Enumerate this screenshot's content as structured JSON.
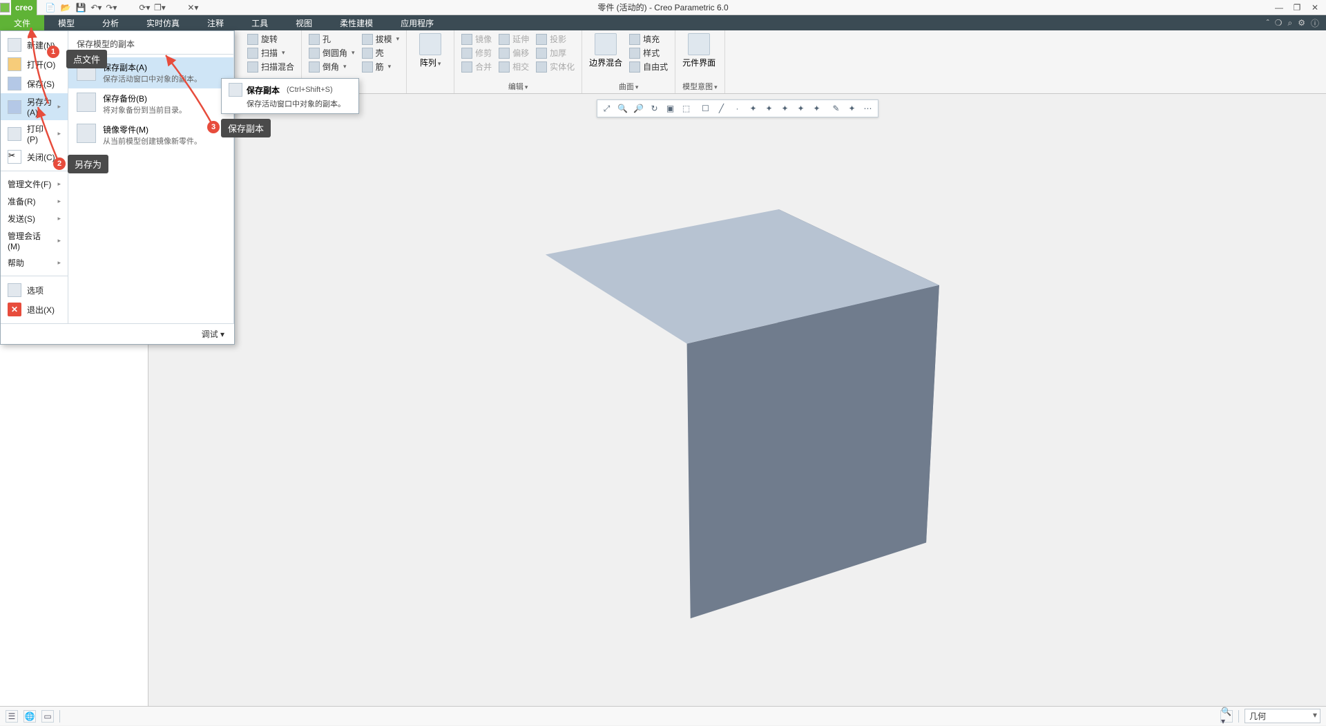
{
  "app": {
    "logo": "creo",
    "title": "零件 (活动的) - Creo Parametric 6.0"
  },
  "tabs": {
    "file": "文件",
    "model": "模型",
    "analysis": "分析",
    "realtime": "实时仿真",
    "annotate": "注释",
    "tools": "工具",
    "view": "视图",
    "flex": "柔性建模",
    "apps": "应用程序"
  },
  "ribbon": {
    "rotate": "旋转",
    "sweep": "扫描",
    "sweep_blend": "扫描混合",
    "hole": "孔",
    "round": "倒圆角",
    "chamfer": "倒角",
    "draft": "拔模",
    "shell": "壳",
    "rib": "筋",
    "pattern": "阵列",
    "mirror": "镜像",
    "trim": "修剪",
    "merge": "合并",
    "extend": "延伸",
    "offset": "偏移",
    "intersect": "相交",
    "thicken": "加厚",
    "project": "投影",
    "solidify": "实体化",
    "fill": "填充",
    "style": "样式",
    "freeform": "自由式",
    "boundary": "边界混合",
    "compui": "元件界面",
    "group_edit": "编辑",
    "group_surface": "曲面",
    "group_model_intent": "模型意图"
  },
  "file_menu": {
    "new": "新建(N)",
    "open": "打开(O)",
    "save": "保存(S)",
    "saveas": "另存为(A)",
    "print": "打印(P)",
    "close": "关闭(C)",
    "manage_file": "管理文件(F)",
    "prepare": "准备(R)",
    "send": "发送(S)",
    "manage_session": "管理会话(M)",
    "help": "帮助",
    "options": "选项",
    "exit": "退出(X)",
    "debug": "调试",
    "col2_header": "保存模型的副本",
    "save_copy_t": "保存副本(A)",
    "save_copy_d": "保存活动窗口中对象的副本。",
    "backup_t": "保存备份(B)",
    "backup_d": "将对象备份到当前目录。",
    "mirror_t": "镜像零件(M)",
    "mirror_d": "从当前模型创建镜像新零件。"
  },
  "tooltip": {
    "title": "保存副本",
    "shortcut": "(Ctrl+Shift+S)",
    "desc": "保存活动窗口中对象的副本。"
  },
  "callouts": {
    "n1": "1",
    "t1": "点文件",
    "n2": "2",
    "t2": "另存为",
    "n3": "3",
    "t3": "保存副本"
  },
  "status": {
    "combo": "几何"
  }
}
